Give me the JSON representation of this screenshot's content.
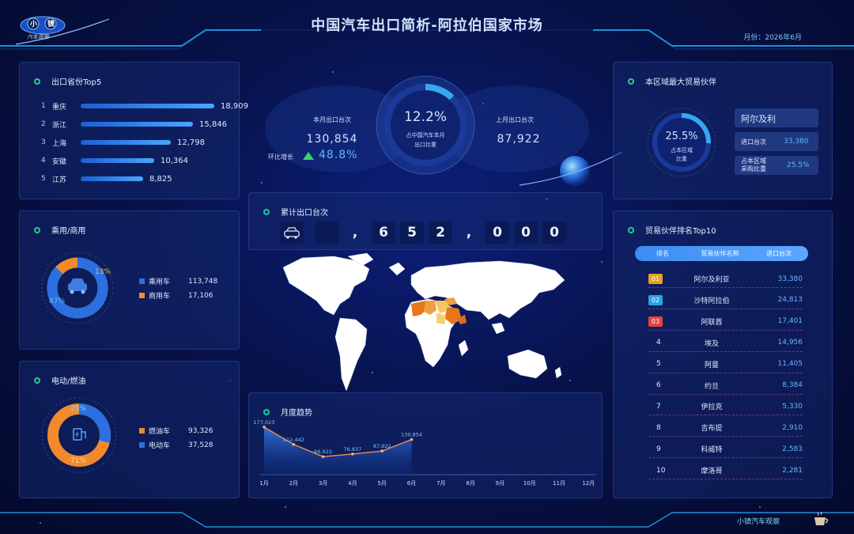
{
  "header": {
    "title": "中国汽车出口简析-阿拉伯国家市场",
    "month_label": "月份：2026年6月",
    "logo_text": "汽车观察",
    "logo_chars": [
      "小",
      "镜"
    ]
  },
  "top5": {
    "title": "出口省份Top5",
    "items": [
      {
        "rank": "1",
        "name": "重庆",
        "value": "18,909",
        "num": 18909
      },
      {
        "rank": "2",
        "name": "浙江",
        "value": "15,846",
        "num": 15846
      },
      {
        "rank": "3",
        "name": "上海",
        "value": "12,798",
        "num": 12798
      },
      {
        "rank": "4",
        "name": "安徽",
        "value": "10,364",
        "num": 10364
      },
      {
        "rank": "5",
        "name": "江苏",
        "value": "8,825",
        "num": 8825
      }
    ]
  },
  "vehicle_type": {
    "title": "乘用/商用",
    "passenger_label": "乘用车",
    "passenger_value": "113,748",
    "commercial_label": "商用车",
    "commercial_value": "17,106",
    "passenger_pct": "87%",
    "commercial_pct": "13%",
    "passenger_fraction": 0.87,
    "colors": {
      "passenger": "#2b6fe0",
      "commercial": "#f08a2c"
    }
  },
  "power_type": {
    "title": "电动/燃油",
    "fuel_label": "燃油车",
    "fuel_value": "93,326",
    "ev_label": "电动车",
    "ev_value": "37,528",
    "fuel_pct": "71%",
    "ev_pct": "29%",
    "ev_fraction": 0.29,
    "colors": {
      "fuel": "#f08a2c",
      "ev": "#2b6fe0"
    }
  },
  "center_kpi": {
    "this_month_label": "本月出口台次",
    "this_month_value": "130,854",
    "mom_label": "环比增长",
    "mom_value": "48.8%",
    "share_value": "12.2%",
    "share_fraction": 0.122,
    "share_label_line1": "占中国汽车本月",
    "share_label_line2": "出口比重",
    "last_month_label": "上月出口台次",
    "last_month_value": "87,922"
  },
  "counter": {
    "title": "累计出口台次",
    "chars": [
      "",
      ",",
      "6",
      "5",
      "2",
      ",",
      "0",
      "0",
      "0"
    ]
  },
  "region": {
    "title": "本区域最大贸易伙伴",
    "share_value": "25.5%",
    "share_fraction": 0.255,
    "share_label_line1": "占本区域",
    "share_label_line2": "比重",
    "partner_name": "阿尔及利",
    "import_label": "进口台次",
    "import_value": "33,380",
    "purchase_label_line1": "占本区域",
    "purchase_label_line2": "采购比重",
    "purchase_value": "25.5%"
  },
  "partners": {
    "title": "贸易伙伴排名Top10",
    "headers": [
      "排名",
      "贸易伙伴名称",
      "进口台次"
    ],
    "rows": [
      {
        "rank": "01",
        "name": "阿尔及利亚",
        "value": "33,380",
        "badge": "#e8a21c"
      },
      {
        "rank": "02",
        "name": "沙特阿拉伯",
        "value": "24,813",
        "badge": "#2aa3e6"
      },
      {
        "rank": "03",
        "name": "阿联酋",
        "value": "17,401",
        "badge": "#e0433f"
      },
      {
        "rank": "4",
        "name": "埃及",
        "value": "14,956",
        "badge": ""
      },
      {
        "rank": "5",
        "name": "阿曼",
        "value": "11,405",
        "badge": ""
      },
      {
        "rank": "6",
        "name": "约旦",
        "value": "8,384",
        "badge": ""
      },
      {
        "rank": "7",
        "name": "伊拉克",
        "value": "5,330",
        "badge": ""
      },
      {
        "rank": "8",
        "name": "吉布提",
        "value": "2,910",
        "badge": ""
      },
      {
        "rank": "9",
        "name": "科威特",
        "value": "2,583",
        "badge": ""
      },
      {
        "rank": "10",
        "name": "摩洛哥",
        "value": "2,281",
        "badge": ""
      }
    ]
  },
  "trend": {
    "title": "月度趋势"
  },
  "chart_data": {
    "type": "area",
    "x": [
      "1月",
      "2月",
      "3月",
      "4月",
      "5月",
      "6月",
      "7月",
      "8月",
      "9月",
      "10月",
      "11月",
      "12月"
    ],
    "series": [
      {
        "values": [
          177023,
          112442,
          66922,
          76837,
          87922,
          130854
        ],
        "labels": [
          "177,023",
          "112,442",
          "66,922",
          "76,837",
          "87,922",
          "130,854"
        ]
      }
    ],
    "ylim": [
      0,
      200000
    ]
  },
  "footer": {
    "brand": "小镜汽车观察"
  }
}
